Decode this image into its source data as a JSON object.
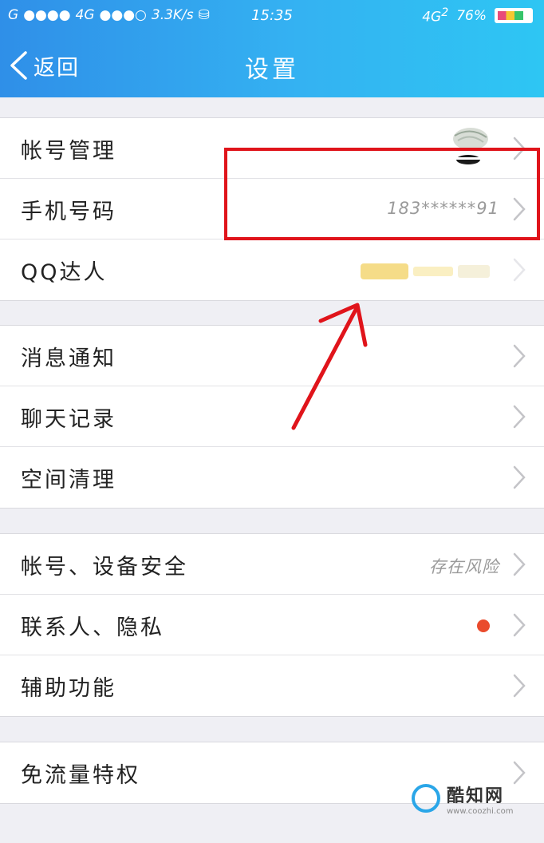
{
  "status_bar": {
    "carrier1": "G",
    "network1": "4G",
    "speed": "3.3K/s",
    "time": "15:35",
    "network_right": "4G",
    "sim_badge": "2",
    "battery": "76%",
    "battery_level": 0.76
  },
  "nav": {
    "back_label": "返回",
    "title": "设置"
  },
  "groups": [
    {
      "rows": [
        {
          "label": "帐号管理",
          "value": ""
        },
        {
          "label": "手机号码",
          "value": "183******91"
        },
        {
          "label": "QQ达人",
          "value": ""
        }
      ]
    },
    {
      "rows": [
        {
          "label": "消息通知",
          "value": ""
        },
        {
          "label": "聊天记录",
          "value": ""
        },
        {
          "label": "空间清理",
          "value": ""
        }
      ]
    },
    {
      "rows": [
        {
          "label": "帐号、设备安全",
          "value": "存在风险"
        },
        {
          "label": "联系人、隐私",
          "value": ""
        },
        {
          "label": "辅助功能",
          "value": ""
        }
      ]
    },
    {
      "rows": [
        {
          "label": "免流量特权",
          "value": ""
        }
      ]
    }
  ],
  "watermark": {
    "title": "酷知网",
    "url": "www.coozhi.com"
  },
  "colors": {
    "header_start": "#2f8fe8",
    "header_end": "#2ec6f3",
    "highlight": "#e0141b",
    "red_dot": "#ea4b2d",
    "background": "#efeff4"
  },
  "icons": [
    "chevron-left-icon",
    "chevron-right-icon",
    "signal-icon",
    "battery-icon",
    "sim-icon"
  ]
}
